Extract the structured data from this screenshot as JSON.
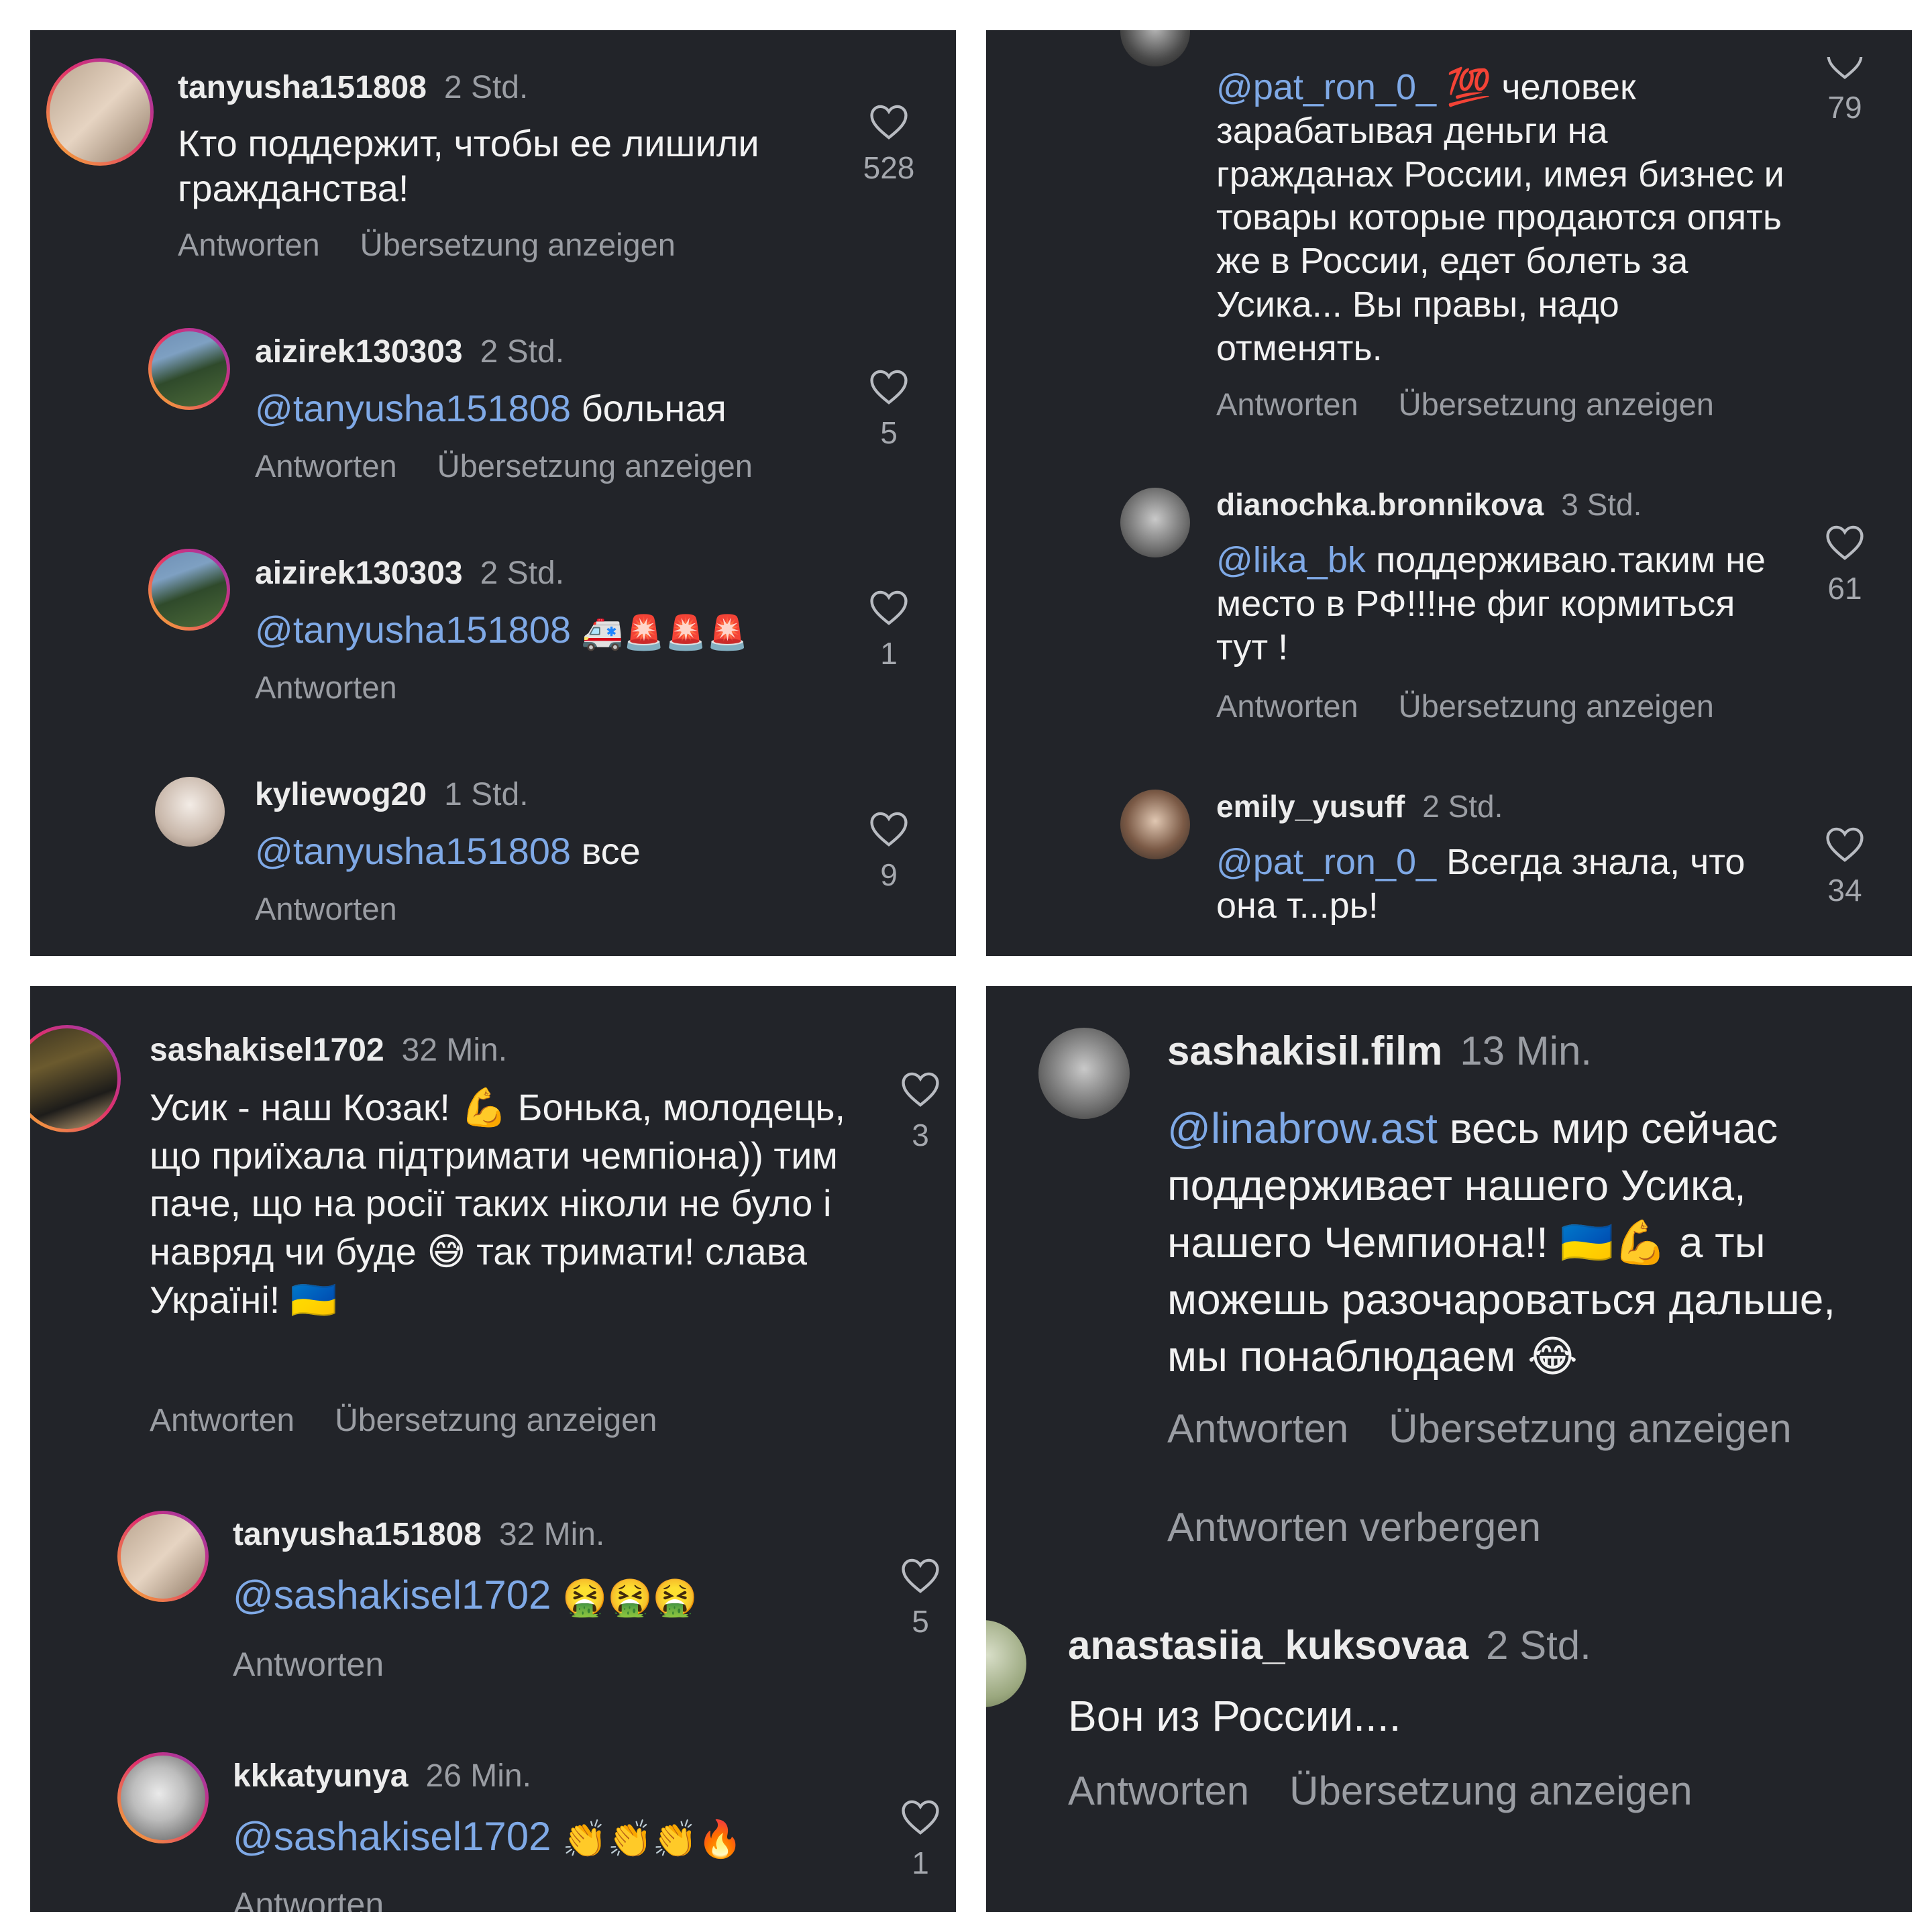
{
  "panels": [
    {
      "comments": [
        {
          "user": "tanyusha151808",
          "time": "2 Std.",
          "text": "Кто поддержит, чтобы ее лишили гражданства!",
          "likes": "528",
          "reply": "Antworten",
          "translate": "Übersetzung anzeigen"
        },
        {
          "user": "aizirek130303",
          "time": "2 Std.",
          "mention": "@tanyusha151808",
          "text": "больная",
          "likes": "5",
          "reply": "Antworten",
          "translate": "Übersetzung anzeigen"
        },
        {
          "user": "aizirek130303",
          "time": "2 Std.",
          "mention": "@tanyusha151808",
          "text": "🚑🚨🚨🚨",
          "likes": "1",
          "reply": "Antworten"
        },
        {
          "user": "kyliewog20",
          "time": "1 Std.",
          "mention": "@tanyusha151808",
          "text": "все",
          "likes": "9",
          "reply": "Antworten"
        }
      ]
    },
    {
      "comments": [
        {
          "mention": "@pat_ron_0_",
          "text": "💯 человек зарабатывая деньги на гражданах России, имея бизнес и товары которые продаются опять же в России, едет болеть за Усика... Вы правы, надо отменять.",
          "likes": "79",
          "reply": "Antworten",
          "translate": "Übersetzung anzeigen"
        },
        {
          "user": "dianochka.bronnikova",
          "time": "3 Std.",
          "mention": "@lika_bk",
          "text": "поддерживаю.таким не место в РФ!!!не фиг кормиться тут !",
          "likes": "61",
          "reply": "Antworten",
          "translate": "Übersetzung anzeigen"
        },
        {
          "user": "emily_yusuff",
          "time": "2 Std.",
          "mention": "@pat_ron_0_",
          "text": "Всегда знала, что она т...рь!",
          "likes": "34"
        }
      ]
    },
    {
      "comments": [
        {
          "user": "sashakisel1702",
          "time": "32 Min.",
          "text": "Усик - наш Козак! 💪 Бонька, молодець, що приїхала підтримати чемпіона)) тим паче, що на росії таких ніколи не було і навряд чи буде 😅 так тримати! слава Україні! 🇺🇦",
          "likes": "3",
          "reply": "Antworten",
          "translate": "Übersetzung anzeigen"
        },
        {
          "user": "tanyusha151808",
          "time": "32 Min.",
          "mention": "@sashakisel1702",
          "text": "🤮🤮🤮",
          "likes": "5",
          "reply": "Antworten"
        },
        {
          "user": "kkkatyunya",
          "time": "26 Min.",
          "mention": "@sashakisel1702",
          "text": "👏👏👏🔥",
          "likes": "1",
          "reply": "Antworten"
        }
      ]
    },
    {
      "comments": [
        {
          "user": "sashakisil.film",
          "time": "13 Min.",
          "mention": "@linabrow.ast",
          "text": " весь мир сейчас поддерживает нашего Усика, нашего Чемпиона!! 🇺🇦💪 а ты можешь разочароваться дальше, мы понаблюдаем 😂",
          "reply": "Antworten",
          "translate": "Übersetzung anzeigen",
          "hide_replies": "Antworten verbergen"
        },
        {
          "user": "anastasiia_kuksovaa",
          "time": "2 Std.",
          "text": "Вон из России....",
          "reply": "Antworten",
          "translate": "Übersetzung anzeigen"
        }
      ]
    }
  ],
  "colors": {
    "panel_bg": "#222429",
    "text": "#f2f2f2",
    "muted": "#9a9da3",
    "mention": "#7fa9e6"
  },
  "icons": {
    "like": "heart-outline-icon"
  }
}
